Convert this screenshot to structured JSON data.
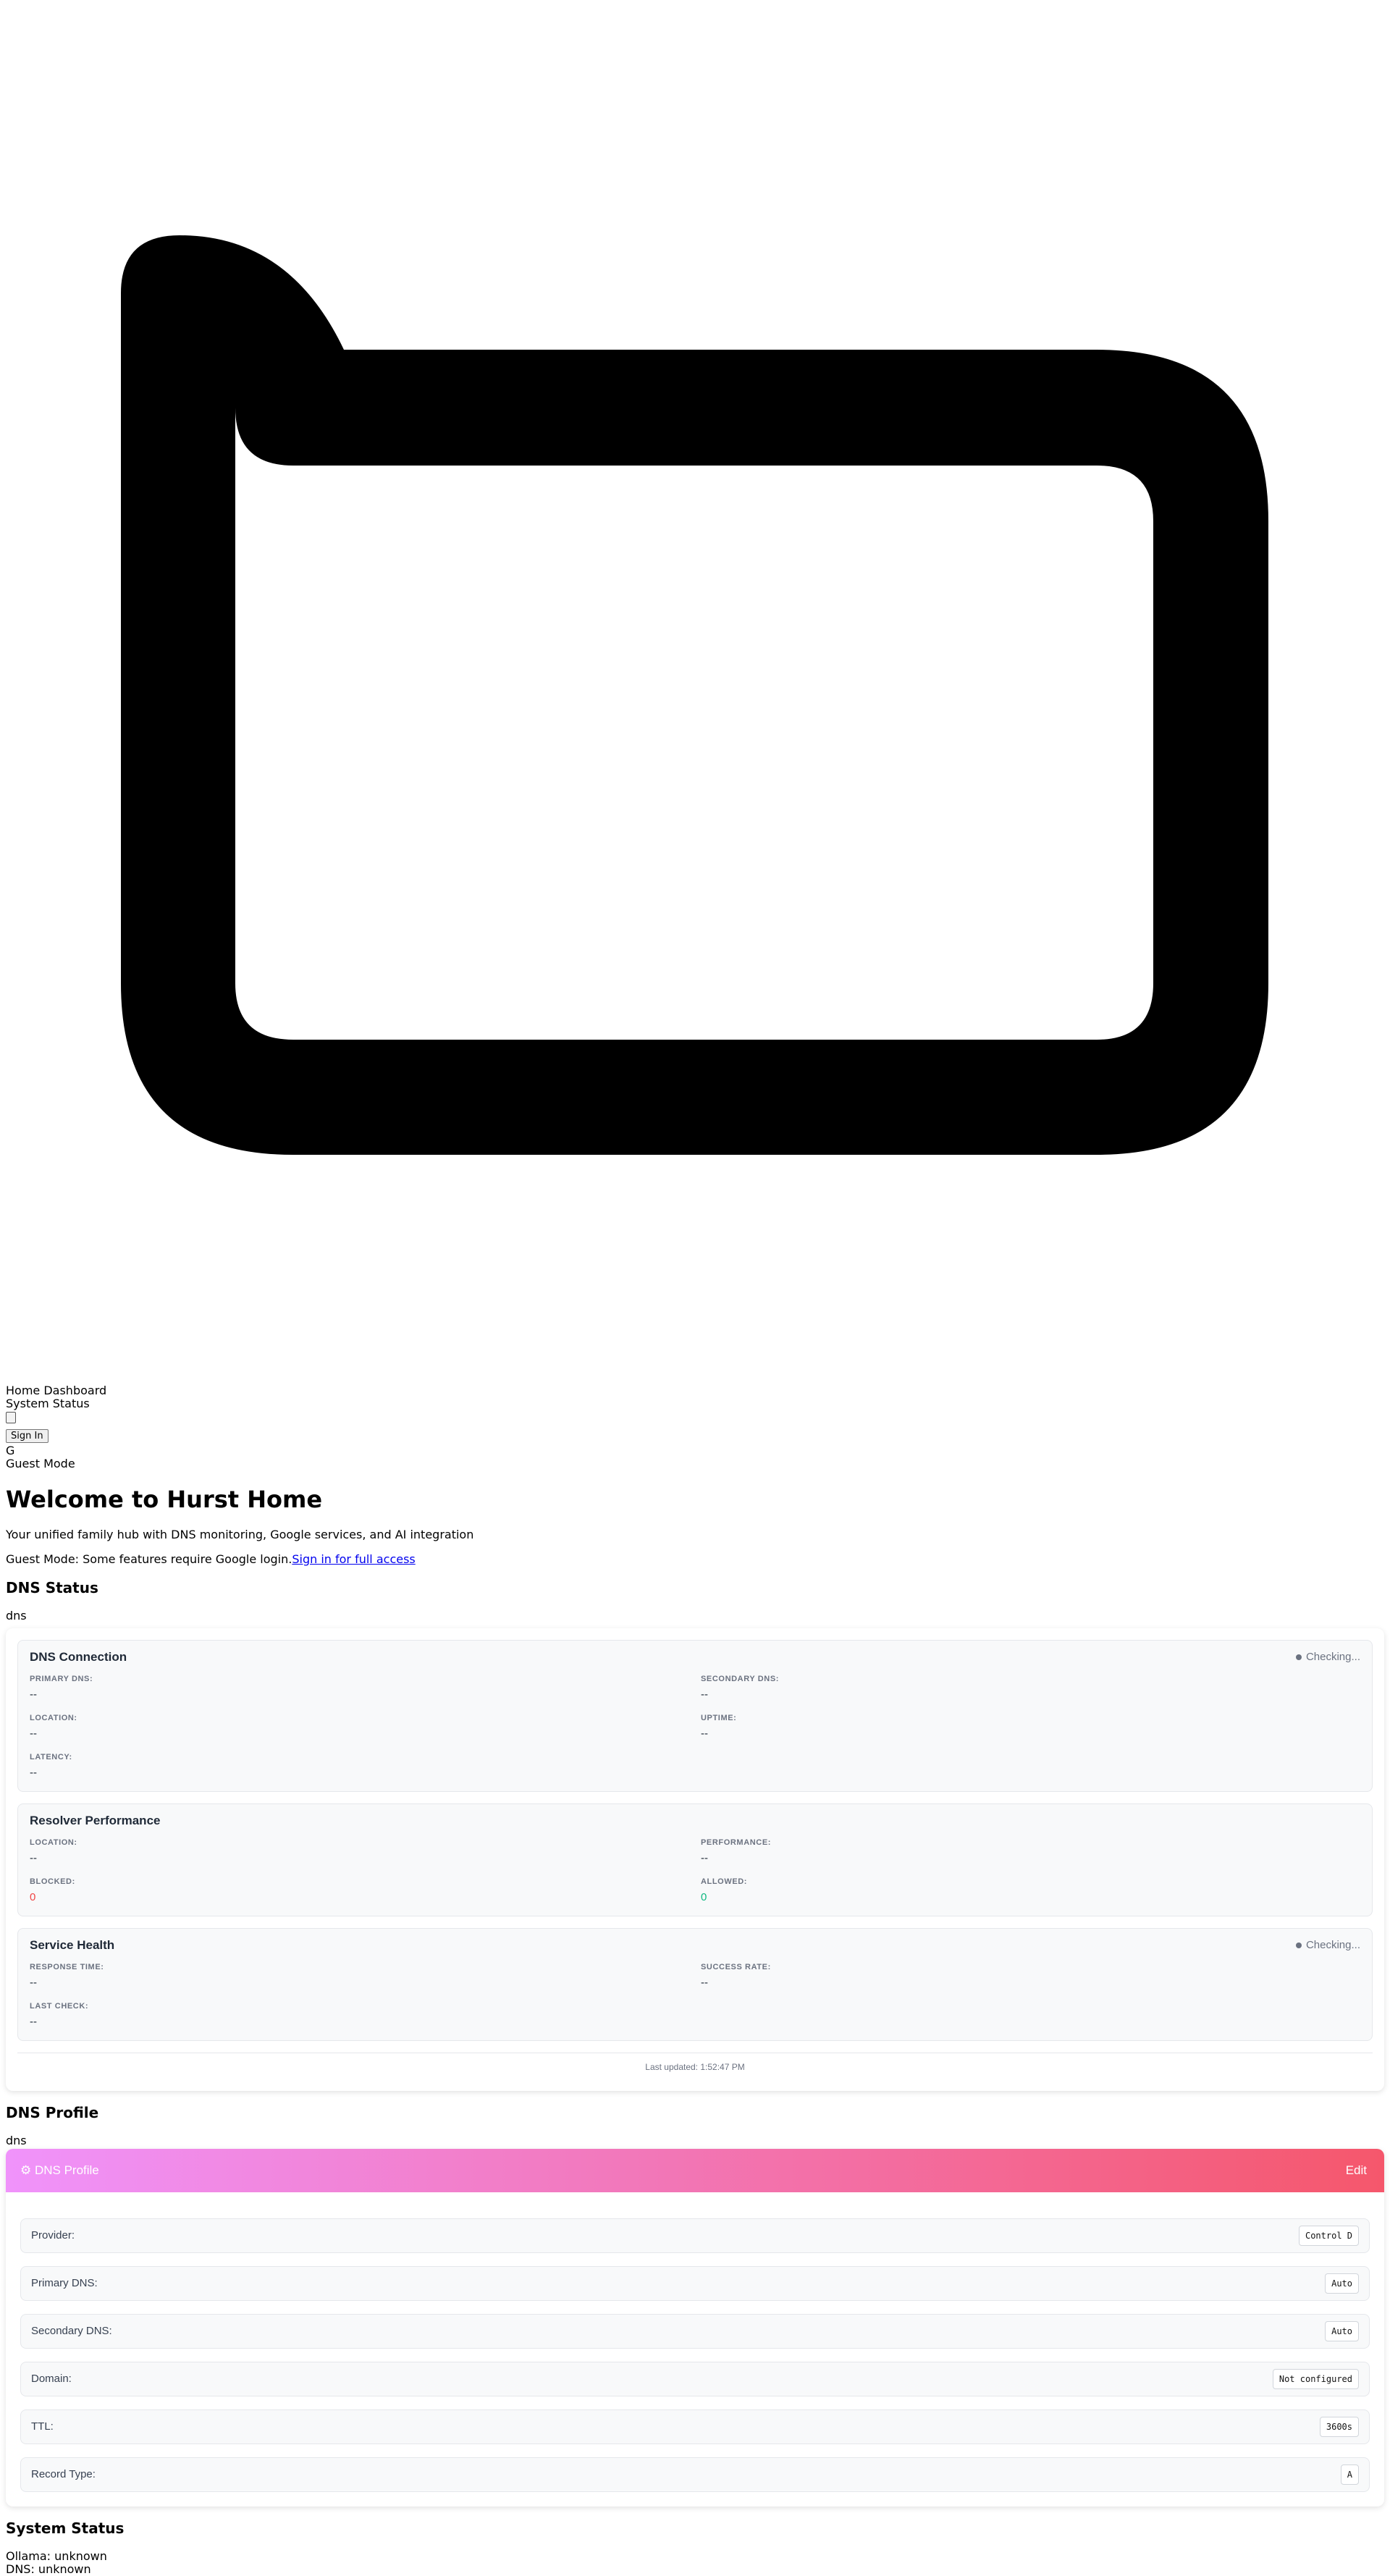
{
  "nav": {
    "title": "Home Dashboard",
    "subtitle": "System Status",
    "sign_in_button": "Sign In",
    "avatar_letter": "G",
    "guest_mode": "Guest Mode"
  },
  "hero": {
    "icon": "folder-icon",
    "heading": "Welcome to Hurst Home",
    "tagline": "Your unified family hub with DNS monitoring, Google services, and AI integration",
    "guest_notice": "Guest Mode: Some features require Google login.",
    "guest_link": "Sign in for full access"
  },
  "dns_status": {
    "title": "DNS Status",
    "subtitle": "dns",
    "connection": {
      "title": "DNS Connection",
      "status": "Checking...",
      "primary_label": "PRIMARY DNS:",
      "primary_value": "--",
      "secondary_label": "SECONDARY DNS:",
      "secondary_value": "--",
      "location_label": "LOCATION:",
      "location_value": "--",
      "uptime_label": "UPTIME:",
      "uptime_value": "--",
      "latency_label": "LATENCY:",
      "latency_value": "--"
    },
    "resolver": {
      "title": "Resolver Performance",
      "location_label": "LOCATION:",
      "location_value": "--",
      "performance_label": "PERFORMANCE:",
      "performance_value": "--",
      "blocked_label": "BLOCKED:",
      "blocked_value": "0",
      "allowed_label": "ALLOWED:",
      "allowed_value": "0"
    },
    "health": {
      "title": "Service Health",
      "status": "Checking...",
      "response_label": "RESPONSE TIME:",
      "response_value": "--",
      "success_label": "SUCCESS RATE:",
      "success_value": "--",
      "lastcheck_label": "LAST CHECK:",
      "lastcheck_value": "--"
    },
    "last_updated": "Last updated: 1:52:47 PM"
  },
  "dns_profile": {
    "title": "DNS Profile",
    "subtitle": "dns",
    "card_title": "⚙ DNS Profile",
    "edit": "Edit",
    "rows": [
      {
        "label": "Provider:",
        "value": "Control D"
      },
      {
        "label": "Primary DNS:",
        "value": "Auto"
      },
      {
        "label": "Secondary DNS:",
        "value": "Auto"
      },
      {
        "label": "Domain:",
        "value": "Not configured"
      },
      {
        "label": "TTL:",
        "value": "3600s"
      },
      {
        "label": "Record Type:",
        "value": "A"
      }
    ]
  },
  "system_status": {
    "title": "System Status",
    "ollama": "Ollama: unknown",
    "dns": "DNS: unknown"
  },
  "colors": {
    "gradient_start": "#f093fb",
    "gradient_end": "#f5576c",
    "blocked": "#ef4444",
    "allowed": "#10b981",
    "link": "#0000ee"
  }
}
